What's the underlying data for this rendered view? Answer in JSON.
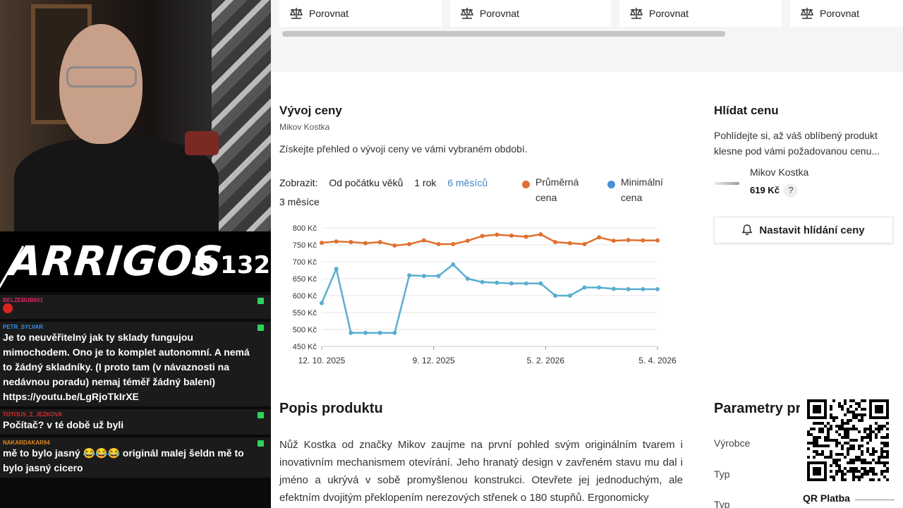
{
  "stream": {
    "logo": "ARRIGOS",
    "code": "K 132",
    "chat": [
      {
        "user": "BELZEBUB001",
        "color": "#e0245e",
        "text": "",
        "emote": true
      },
      {
        "user": "PETR_SYLVAR",
        "color": "#3b8de0",
        "text": "Je to neuvěřitelný jak ty sklady fungujou mimochodem. Ono je to komplet autonomní. A nemá to žádný skladníky. (I proto tam (v návaznosti na nedávnou poradu) nemaj téměř žádný balení) https://youtu.be/LgRjoTkIrXE",
        "emote": false
      },
      {
        "user": "TOTOUS_Z_JEZKOVA",
        "color": "#d92b2b",
        "text": "Počítač? v té době už byli",
        "emote": false
      },
      {
        "user": "NAKARDAKAR94",
        "color": "#e08a1e",
        "text": "mě to bylo jasný 😂😂😂 originál malej šeldn mě to bylo jasný cicero",
        "emote": false
      }
    ]
  },
  "compare": {
    "label": "Porovnat"
  },
  "price_history": {
    "title": "Vývoj ceny",
    "product": "Mikov Kostka",
    "description": "Získejte přehled o vývoji ceny ve vámi vybraném období.",
    "show_label": "Zobrazit:",
    "ranges": [
      "Od počátku věků",
      "1 rok",
      "6 měsíců",
      "3 měsíce"
    ],
    "active_range": "6 měsíců",
    "legend_avg": "Průměrná cena",
    "legend_min": "Minimální cena"
  },
  "watch": {
    "title": "Hlídat cenu",
    "text": "Pohlídejte si, až váš oblíbený produkt klesne pod vámi požadovanou cenu...",
    "product": "Mikov Kostka",
    "price": "619 Kč",
    "help": "?",
    "button": "Nastavit hlídání ceny"
  },
  "description": {
    "title": "Popis produktu",
    "text": "Nůž Kostka od značky Mikov zaujme na první pohled svým originálním tvarem i inovativním mechanismem otevírání. Jeho hranatý design v zavřeném stavu mu dal i jméno a ukrývá v sobě promyšlenou konstrukci. Otevřete jej jednoduchým, ale efektním dvojitým překlopením nerezových střenek o 180 stupňů. Ergonomicky"
  },
  "parameters": {
    "title": "Parametry pr",
    "labels": [
      "Výrobce",
      "Typ",
      "Typ"
    ]
  },
  "qr": {
    "label": "QR Platba"
  },
  "colors": {
    "avg": "#e07030",
    "min": "#5aaed0",
    "active": "#3b86c9"
  },
  "chart_data": {
    "type": "line",
    "title": "",
    "xlabel": "",
    "ylabel": "",
    "ylim": [
      450,
      800
    ],
    "yticks": [
      "800 Kč",
      "750 Kč",
      "700 Kč",
      "650 Kč",
      "600 Kč",
      "550 Kč",
      "500 Kč",
      "450 Kč"
    ],
    "xticks": [
      "12. 10. 2025",
      "9. 12. 2025",
      "5. 2. 2026",
      "5. 4. 2026"
    ],
    "series": [
      {
        "name": "Průměrná cena",
        "color": "#e07030",
        "values": [
          756,
          760,
          758,
          755,
          758,
          748,
          752,
          763,
          752,
          752,
          762,
          776,
          780,
          777,
          774,
          781,
          758,
          755,
          752,
          772,
          762,
          764,
          763,
          763
        ]
      },
      {
        "name": "Minimální cena",
        "color": "#5aaed0",
        "values": [
          578,
          679,
          490,
          490,
          490,
          490,
          660,
          658,
          658,
          692,
          650,
          640,
          638,
          636,
          636,
          636,
          600,
          600,
          624,
          624,
          620,
          619,
          619,
          619
        ]
      }
    ]
  }
}
